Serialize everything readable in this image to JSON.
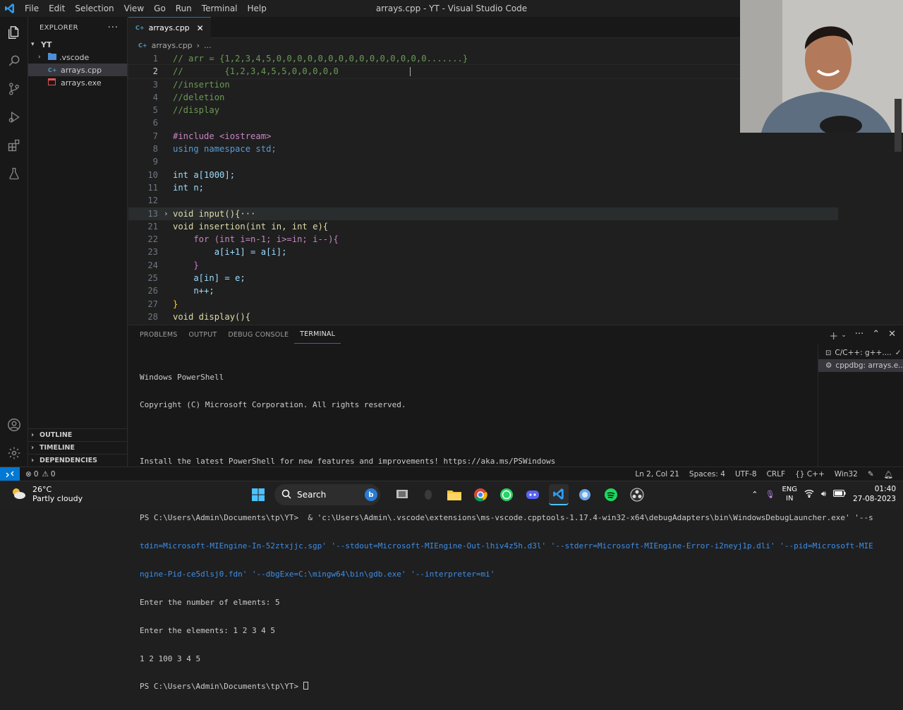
{
  "window": {
    "title": "arrays.cpp - YT - Visual Studio Code"
  },
  "menu": [
    "File",
    "Edit",
    "Selection",
    "View",
    "Go",
    "Run",
    "Terminal",
    "Help"
  ],
  "explorer": {
    "header": "EXPLORER",
    "root": "YT",
    "items": [
      ".vscode",
      "arrays.cpp",
      "arrays.exe"
    ],
    "sections": [
      "OUTLINE",
      "TIMELINE",
      "DEPENDENCIES"
    ]
  },
  "editor": {
    "tab": "arrays.cpp",
    "breadcrumb": [
      "arrays.cpp",
      "..."
    ],
    "lines": [
      {
        "n": "1",
        "t": "// arr = {1,2,3,4,5,0,0,0,0,0,0,0,0,0,0,0,0,0,0,0.......}"
      },
      {
        "n": "2",
        "t": "//        {1,2,3,4,5,5,0,0,0,0,0"
      },
      {
        "n": "3",
        "t": "//insertion"
      },
      {
        "n": "4",
        "t": "//deletion"
      },
      {
        "n": "5",
        "t": "//display"
      },
      {
        "n": "6",
        "t": ""
      },
      {
        "n": "7",
        "t": "#include <iostream>"
      },
      {
        "n": "8",
        "t": "using namespace std;"
      },
      {
        "n": "9",
        "t": ""
      },
      {
        "n": "10",
        "t": "int a[1000];"
      },
      {
        "n": "11",
        "t": "int n;"
      },
      {
        "n": "12",
        "t": ""
      },
      {
        "n": "13",
        "t": "void input(){···"
      },
      {
        "n": "21",
        "t": "void insertion(int in, int e){"
      },
      {
        "n": "22",
        "t": "    for (int i=n-1; i>=in; i--){"
      },
      {
        "n": "23",
        "t": "        a[i+1] = a[i];"
      },
      {
        "n": "24",
        "t": "    }"
      },
      {
        "n": "25",
        "t": "    a[in] = e;"
      },
      {
        "n": "26",
        "t": "    n++;"
      },
      {
        "n": "27",
        "t": "}"
      },
      {
        "n": "28",
        "t": "void display(){"
      }
    ]
  },
  "panel": {
    "tabs": [
      "PROBLEMS",
      "OUTPUT",
      "DEBUG CONSOLE",
      "TERMINAL"
    ],
    "terminal_lines": [
      "Windows PowerShell",
      "Copyright (C) Microsoft Corporation. All rights reserved.",
      "",
      "Install the latest PowerShell for new features and improvements! https://aka.ms/PSWindows",
      "",
      "PS C:\\Users\\Admin\\Documents\\tp\\YT>  & 'c:\\Users\\Admin\\.vscode\\extensions\\ms-vscode.cpptools-1.17.4-win32-x64\\debugAdapters\\bin\\WindowsDebugLauncher.exe' '--s",
      "tdin=Microsoft-MIEngine-In-52ztxjjc.sgp' '--stdout=Microsoft-MIEngine-Out-lhiv4z5h.d3l' '--stderr=Microsoft-MIEngine-Error-i2neyj1p.dli' '--pid=Microsoft-MIE",
      "ngine-Pid-ce5dlsj0.fdn' '--dbgExe=C:\\mingw64\\bin\\gdb.exe' '--interpreter=mi'",
      "Enter the number of elments: 5",
      "Enter the elements: 1 2 3 4 5",
      "1 2 100 3 4 5",
      "PS C:\\Users\\Admin\\Documents\\tp\\YT> "
    ],
    "terminal_list": [
      "C/C++: g++....",
      "cppdbg: arrays.e..."
    ]
  },
  "status": {
    "errors": "0",
    "warnings": "0",
    "position": "Ln 2, Col 21",
    "spaces": "Spaces: 4",
    "encoding": "UTF-8",
    "eol": "CRLF",
    "language": "C++",
    "platform": "Win32"
  },
  "taskbar": {
    "temp": "26°C",
    "weather": "Partly cloudy",
    "search": "Search",
    "lang1": "ENG",
    "lang2": "IN",
    "time": "01:40",
    "date": "27-08-2023"
  }
}
